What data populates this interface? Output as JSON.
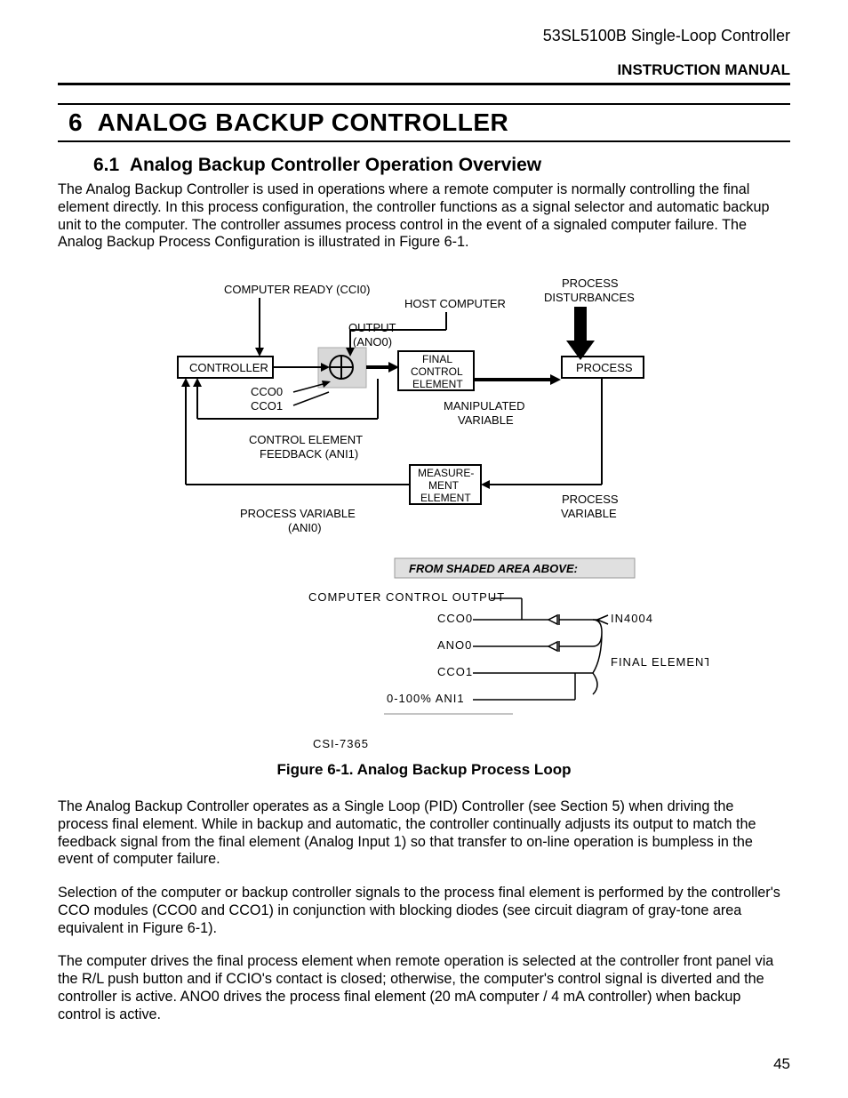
{
  "header": {
    "docid": "53SL5100B Single-Loop Controller",
    "manual": "INSTRUCTION MANUAL"
  },
  "chapter": {
    "num": "6",
    "title": "ANALOG BACKUP CONTROLLER"
  },
  "section": {
    "num": "6.1",
    "title": "Analog Backup Controller Operation Overview"
  },
  "para1": "The Analog Backup Controller is used in operations where a remote computer is normally controlling the final element directly. In this process configuration, the controller functions as a signal selector and automatic backup unit to the computer. The controller assumes process control in the event of a signaled computer failure. The Analog Backup Process Configuration is illustrated in Figure 6-1.",
  "figure": {
    "computer_ready": "COMPUTER READY (CCI0)",
    "host": "HOST COMPUTER",
    "disturb1": "PROCESS",
    "disturb2": "DISTURBANCES",
    "output1": "OUTPUT",
    "output2": "(ANO0)",
    "controller": "CONTROLLER",
    "final1": "FINAL",
    "final2": "CONTROL",
    "final3": "ELEMENT",
    "process": "PROCESS",
    "cco0": "CCO0",
    "cco1": "CCO1",
    "manip1": "MANIPULATED",
    "manip2": "VARIABLE",
    "ctrl_elem_fb1": "CONTROL ELEMENT",
    "ctrl_elem_fb2": "FEEDBACK (ANI1)",
    "meas1": "MEASURE-",
    "meas2": "MENT",
    "meas3": "ELEMENT",
    "pv1": "PROCESS VARIABLE",
    "pv2": "(ANI0)",
    "procvar1": "PROCESS",
    "procvar2": "VARIABLE",
    "shaded": "FROM SHADED AREA ABOVE:",
    "compctrl": "COMPUTER CONTROL OUTPUT",
    "d_cco0": "CCO0",
    "d_ano0": "ANO0",
    "d_cco1": "CCO1",
    "d_ani1": "0-100% ANI1",
    "in4004": "IN4004",
    "finalelem": "FINAL ELEMENT",
    "csi": "CSI-7365"
  },
  "figcaption": "Figure 6-1. Analog Backup Process Loop",
  "para2": "The Analog Backup Controller operates as a Single Loop (PID) Controller (see Section 5) when driving the process final element. While in backup and automatic, the controller continually adjusts its output to match the feedback signal from the final element (Analog Input 1) so that transfer to on-line operation is bumpless in the event of computer failure.",
  "para3": "Selection of the computer or backup controller signals to the process final element is performed by the controller's CCO modules (CCO0 and CCO1) in conjunction with blocking diodes (see circuit diagram of gray-tone area equivalent in Figure 6-1).",
  "para4": "The computer drives the final process element when remote operation is selected at the controller front panel via the R/L push button and if CCIO's contact is closed; otherwise, the computer's control signal is diverted and the controller is active. ANO0 drives the process final element (20 mA computer / 4 mA controller) when backup control is active.",
  "pageno": "45"
}
